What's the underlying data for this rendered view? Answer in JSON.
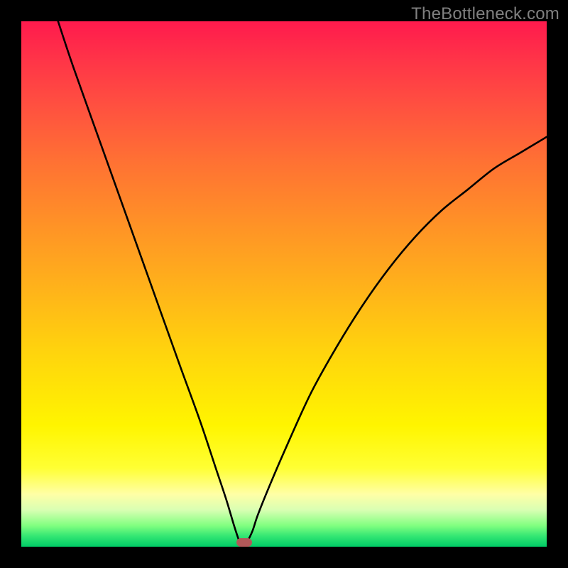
{
  "watermark": "TheBottleneck.com",
  "colors": {
    "page_bg": "#000000",
    "curve_stroke": "#000000",
    "marker_fill": "#b25959",
    "watermark_text": "#808080"
  },
  "chart_data": {
    "type": "line",
    "title": "",
    "xlabel": "",
    "ylabel": "",
    "xlim": [
      0,
      100
    ],
    "ylim": [
      0,
      100
    ],
    "grid": false,
    "legend": false,
    "note": "Normalized 0–100 coordinates; (0,0) is bottom-left of the gradient plot area. Curve is a V-shaped valley with minimum near x≈42 touching y=0; left branch is steep and nearly linear, right branch rises with diminishing slope.",
    "series": [
      {
        "name": "curve",
        "x": [
          7,
          10,
          15,
          20,
          25,
          30,
          34,
          37,
          39,
          40.5,
          41.5,
          42,
          43,
          44,
          45,
          47,
          50,
          55,
          60,
          65,
          70,
          75,
          80,
          85,
          90,
          95,
          100
        ],
        "y": [
          100,
          91,
          77,
          63,
          49,
          35,
          24,
          15,
          9,
          4,
          1,
          0,
          1,
          3,
          6,
          11,
          18,
          29,
          38,
          46,
          53,
          59,
          64,
          68,
          72,
          75,
          78
        ]
      }
    ],
    "marker": {
      "x": 42.4,
      "y": 0.8
    },
    "gradient_stops": [
      {
        "offset": 0.0,
        "color": "#ff1a4d"
      },
      {
        "offset": 0.07,
        "color": "#ff3348"
      },
      {
        "offset": 0.16,
        "color": "#ff5040"
      },
      {
        "offset": 0.27,
        "color": "#ff7233"
      },
      {
        "offset": 0.39,
        "color": "#ff9326"
      },
      {
        "offset": 0.51,
        "color": "#ffb31a"
      },
      {
        "offset": 0.63,
        "color": "#ffd40d"
      },
      {
        "offset": 0.77,
        "color": "#fff500"
      },
      {
        "offset": 0.85,
        "color": "#ffff33"
      },
      {
        "offset": 0.9,
        "color": "#ffffa6"
      },
      {
        "offset": 0.93,
        "color": "#d9ffb3"
      },
      {
        "offset": 0.96,
        "color": "#80ff80"
      },
      {
        "offset": 0.98,
        "color": "#33e673"
      },
      {
        "offset": 1.0,
        "color": "#00cc66"
      }
    ]
  }
}
